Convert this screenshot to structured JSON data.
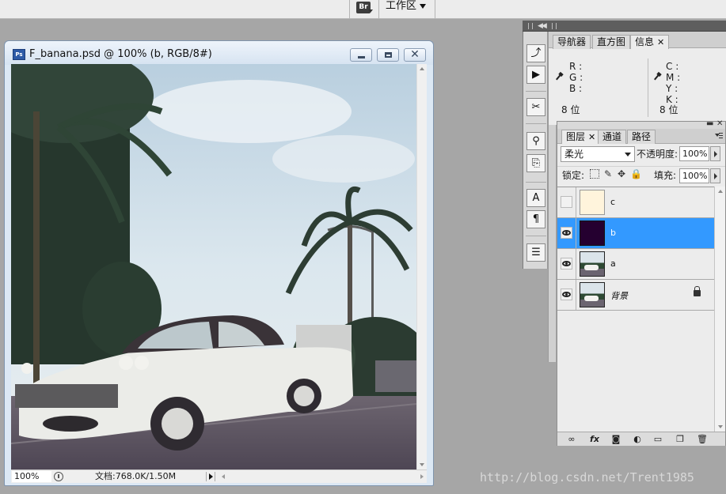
{
  "app": {
    "bridge_icon": "Br",
    "workspace_label": "工作区",
    "workspace_dropdown_icon": "caret-down-icon"
  },
  "document": {
    "ps_icon": "Ps",
    "title": "F_banana.psd @ 100% (b, RGB/8#)",
    "zoom": "100%",
    "doc_info": "文档:768.0K/1.50M"
  },
  "info_panel": {
    "tabs": [
      {
        "label": "导航器",
        "active": false
      },
      {
        "label": "直方图",
        "active": false
      },
      {
        "label": "信息",
        "active": true
      }
    ],
    "close_glyph": "✕",
    "left_channels": [
      "R :",
      "G :",
      "B :"
    ],
    "right_channels": [
      "C :",
      "M :",
      "Y :",
      "K :"
    ],
    "left_bitdepth": "8 位",
    "right_bitdepth": "8 位"
  },
  "layers_panel": {
    "tabs": [
      {
        "label": "图层",
        "active": true
      },
      {
        "label": "通道",
        "active": false
      },
      {
        "label": "路径",
        "active": false
      }
    ],
    "close_glyph": "✕",
    "blend_mode": "柔光",
    "opacity_label": "不透明度:",
    "opacity_value": "100%",
    "lock_label": "锁定:",
    "fill_label": "填充:",
    "fill_value": "100%",
    "layers": [
      {
        "name": "c",
        "visible": false,
        "selected": false,
        "thumb": "cream"
      },
      {
        "name": "b",
        "visible": true,
        "selected": true,
        "thumb": "dark"
      },
      {
        "name": "a",
        "visible": true,
        "selected": false,
        "thumb": "photo"
      },
      {
        "name": "背景",
        "visible": true,
        "selected": false,
        "thumb": "photo",
        "locked": true
      }
    ]
  },
  "watermark": "http://blog.csdn.net/Trent1985",
  "colors": {
    "selection": "#3399ff",
    "workspace_bg": "#a6a6a6"
  }
}
